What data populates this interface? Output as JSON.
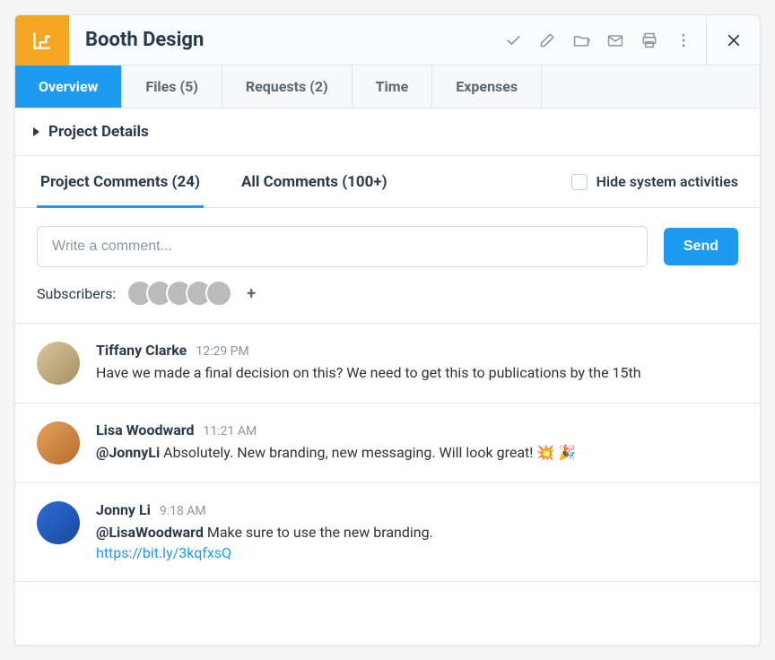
{
  "header": {
    "title": "Booth Design"
  },
  "tabs": [
    {
      "label": "Overview",
      "active": true
    },
    {
      "label": "Files (5)",
      "active": false
    },
    {
      "label": "Requests (2)",
      "active": false
    },
    {
      "label": "Time",
      "active": false
    },
    {
      "label": "Expenses",
      "active": false
    }
  ],
  "details_label": "Project Details",
  "comment_tabs": {
    "project": "Project Comments (24)",
    "all": "All Comments (100+)"
  },
  "hide_system_label": "Hide system activities",
  "compose": {
    "placeholder": "Write a comment...",
    "send_label": "Send"
  },
  "subscribers_label": "Subscribers:",
  "plus_label": "+",
  "comments": [
    {
      "author": "Tiffany Clarke",
      "time": "12:29 PM",
      "text": "Have we made a final decision on this? We need to get this to publications by the 15th"
    },
    {
      "author": "Lisa Woodward",
      "time": "11:21 AM",
      "mention": "@JonnyLi",
      "text_after_mention": " Absolutely. New branding, new messaging. Will look great! 💥 🎉"
    },
    {
      "author": "Jonny Li",
      "time": "9:18 AM",
      "mention": "@LisaWoodward",
      "text_after_mention": " Make sure to use the new branding.",
      "link": "https://bit.ly/3kqfxsQ"
    }
  ]
}
